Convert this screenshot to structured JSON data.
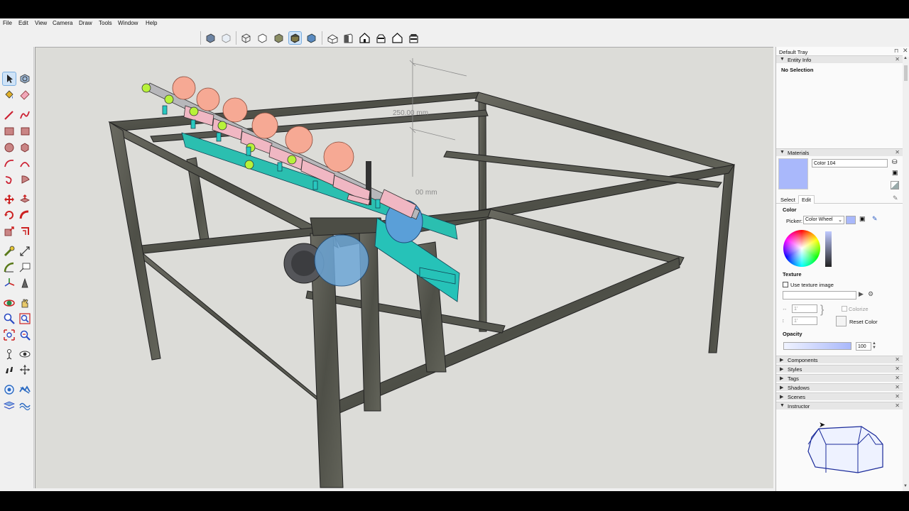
{
  "menu": [
    "File",
    "Edit",
    "View",
    "Camera",
    "Draw",
    "Tools",
    "Window",
    "Help"
  ],
  "viewport": {
    "dimension_primary": "250.00 mm",
    "dimension_secondary": "00 mm"
  },
  "tray": {
    "title": "Default Tray",
    "entity_info": {
      "label": "Entity Info",
      "selection": "No Selection"
    },
    "materials": {
      "label": "Materials",
      "material_name": "Color 104",
      "swatch_color": "#a9b8fb",
      "tabs": [
        "Select",
        "Edit"
      ],
      "color_label": "Color",
      "picker_label": "Picker:",
      "picker_value": "Color Wheel",
      "texture_label": "Texture",
      "use_texture_label": "Use texture image",
      "texture_width": "1'",
      "texture_height": "1'",
      "colorize_label": "Colorize",
      "reset_color_label": "Reset Color",
      "opacity_label": "Opacity",
      "opacity_value": "100",
      "opacity_fraction": 1.0
    },
    "panels": [
      "Components",
      "Styles",
      "Tags",
      "Shadows",
      "Scenes",
      "Instructor"
    ]
  }
}
